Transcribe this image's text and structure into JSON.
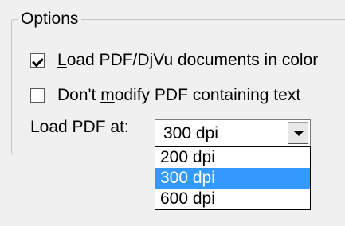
{
  "options_group": {
    "title": "Options",
    "color_checkbox": {
      "checked": true,
      "label_prefix": "",
      "label_underline": "L",
      "label_suffix": "oad PDF/DjVu documents in color"
    },
    "no_modify_checkbox": {
      "checked": false,
      "label_prefix": "Don't ",
      "label_underline": "m",
      "label_suffix": "odify PDF containing text"
    },
    "load_at": {
      "label": "Load PDF at:",
      "selected": "300 dpi",
      "options": [
        "200 dpi",
        "300 dpi",
        "600 dpi"
      ],
      "highlighted_index": 1
    }
  },
  "colors": {
    "highlight": "#3399ff",
    "window_bg": "#f0f0f0"
  }
}
